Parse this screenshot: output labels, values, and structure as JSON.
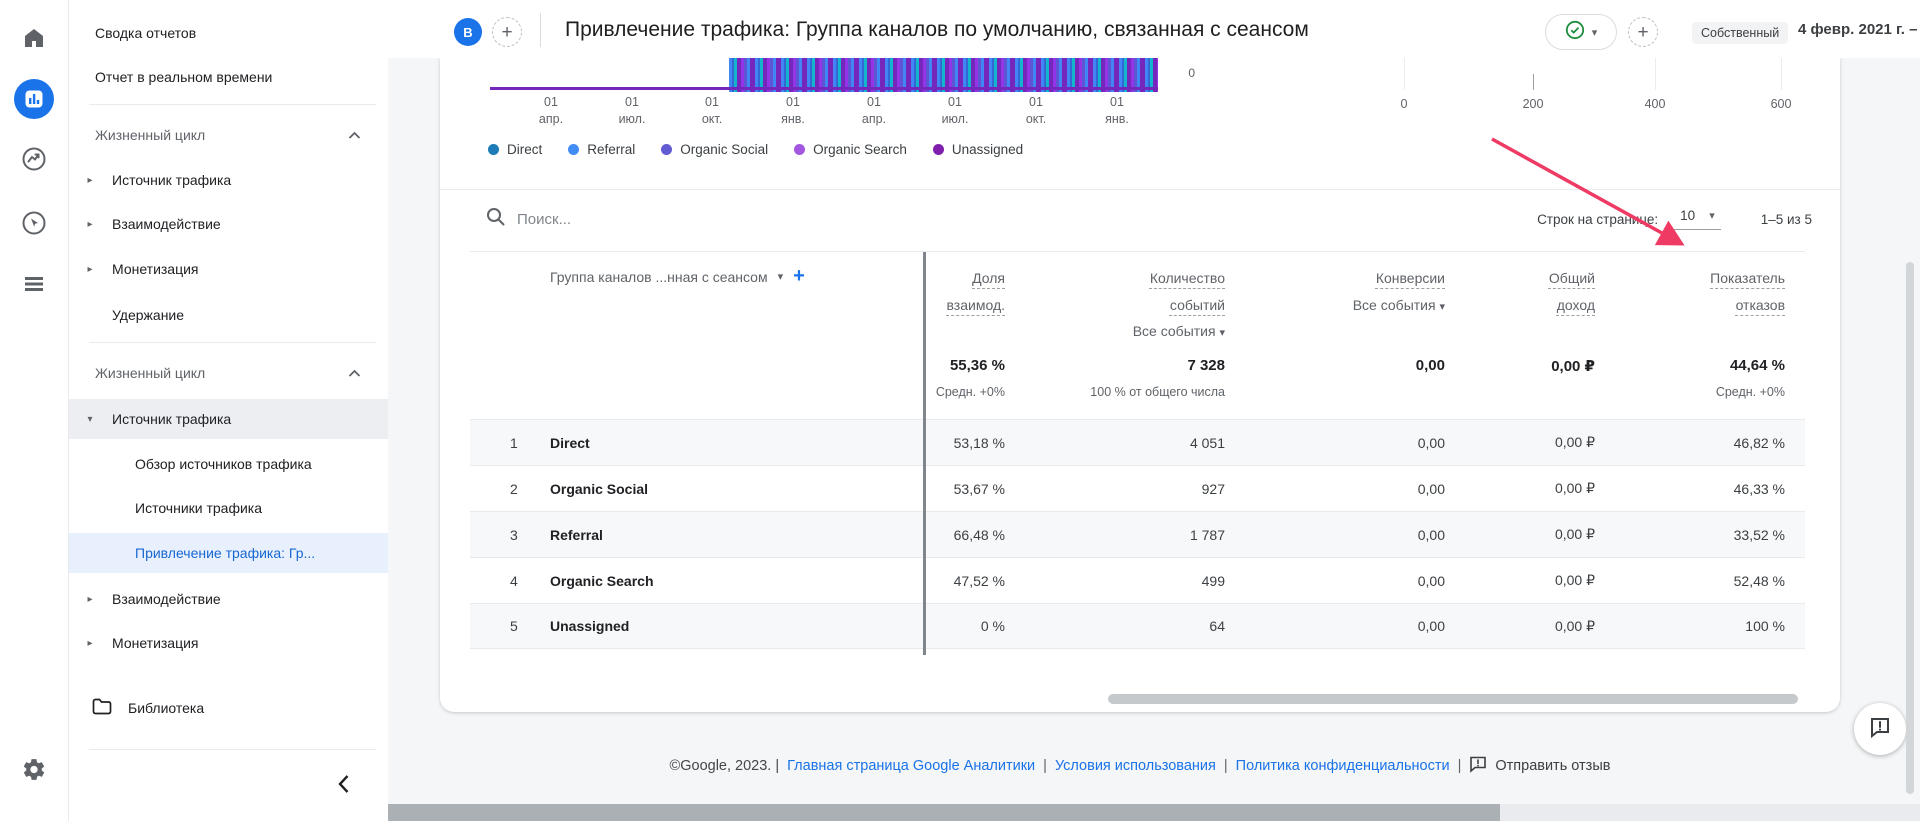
{
  "header": {
    "avatar_letter": "B",
    "title": "Привлечение трафика: Группа каналов по умолчанию, связанная с сеансом",
    "property_badge": "Собственный",
    "date_range": "4 февр. 2021 г. –"
  },
  "sidebar": {
    "summary": "Сводка отчетов",
    "realtime": "Отчет в реальном времени",
    "section1": {
      "label": "Жизненный цикл",
      "items": [
        "Источник трафика",
        "Взаимодействие",
        "Монетизация",
        "Удержание"
      ]
    },
    "section2": {
      "label": "Жизненный цикл",
      "parent": "Источник трафика",
      "children": [
        "Обзор источников трафика",
        "Источники трафика",
        "Привлечение трафика: Гр..."
      ],
      "siblings": [
        "Взаимодействие",
        "Монетизация"
      ]
    },
    "library": "Библиотека"
  },
  "chart": {
    "x_labels": [
      {
        "d": "01",
        "m": "апр."
      },
      {
        "d": "01",
        "m": "июл."
      },
      {
        "d": "01",
        "m": "окт."
      },
      {
        "d": "01",
        "m": "янв."
      },
      {
        "d": "01",
        "m": "апр."
      },
      {
        "d": "01",
        "m": "июл."
      },
      {
        "d": "01",
        "m": "окт."
      },
      {
        "d": "01",
        "m": "янв."
      }
    ],
    "y_axis_zero": "0",
    "mini_axis": [
      "0",
      "200",
      "400",
      "600"
    ],
    "legend": [
      {
        "label": "Direct",
        "color": "#1d7bb8"
      },
      {
        "label": "Referral",
        "color": "#428df5"
      },
      {
        "label": "Organic Social",
        "color": "#635bd3"
      },
      {
        "label": "Organic Search",
        "color": "#a356e0"
      },
      {
        "label": "Unassigned",
        "color": "#801fae"
      }
    ]
  },
  "toolbar": {
    "search_placeholder": "Поиск...",
    "rows_per_page_label": "Строк на странице:",
    "rows_per_page_value": "10",
    "range_label": "1–5 из 5"
  },
  "table": {
    "dim_header": "Группа каналов ...нная с сеансом",
    "col_share": "Доля взаимод.",
    "col_events": "Количество событий",
    "col_conversions": "Конверсии",
    "col_revenue": "Общий доход",
    "col_bounce": "Показатель отказов",
    "events_filter": "Все события",
    "conversions_filter": "Все события",
    "totals": {
      "share": "55,36 %",
      "share_sub": "Средн. +0%",
      "events": "7 328",
      "events_sub": "100 % от общего числа",
      "conversions": "0,00",
      "revenue": "0,00 ₽",
      "bounce": "44,64 %",
      "bounce_sub": "Средн. +0%"
    },
    "rows": [
      {
        "num": "1",
        "channel": "Direct",
        "share": "53,18 %",
        "events": "4 051",
        "conversions": "0,00",
        "revenue": "0,00 ₽",
        "bounce": "46,82 %"
      },
      {
        "num": "2",
        "channel": "Organic Social",
        "share": "53,67 %",
        "events": "927",
        "conversions": "0,00",
        "revenue": "0,00 ₽",
        "bounce": "46,33 %"
      },
      {
        "num": "3",
        "channel": "Referral",
        "share": "66,48 %",
        "events": "1 787",
        "conversions": "0,00",
        "revenue": "0,00 ₽",
        "bounce": "33,52 %"
      },
      {
        "num": "4",
        "channel": "Organic Search",
        "share": "47,52 %",
        "events": "499",
        "conversions": "0,00",
        "revenue": "0,00 ₽",
        "bounce": "52,48 %"
      },
      {
        "num": "5",
        "channel": "Unassigned",
        "share": "0 %",
        "events": "64",
        "conversions": "0,00",
        "revenue": "0,00 ₽",
        "bounce": "100 %"
      }
    ]
  },
  "footer": {
    "copyright": "©Google, 2023. |",
    "link1": "Главная страница Google Аналитики",
    "link2": "Условия использования",
    "link3": "Политика конфиденциальности",
    "separator": "|",
    "feedback": "Отправить отзыв"
  },
  "icons": {
    "plus": "+",
    "caret_down": "▾",
    "arrow_right": "▸",
    "arrow_down": "▾"
  },
  "annotation": {
    "arrow_color": "#ef3a63"
  }
}
